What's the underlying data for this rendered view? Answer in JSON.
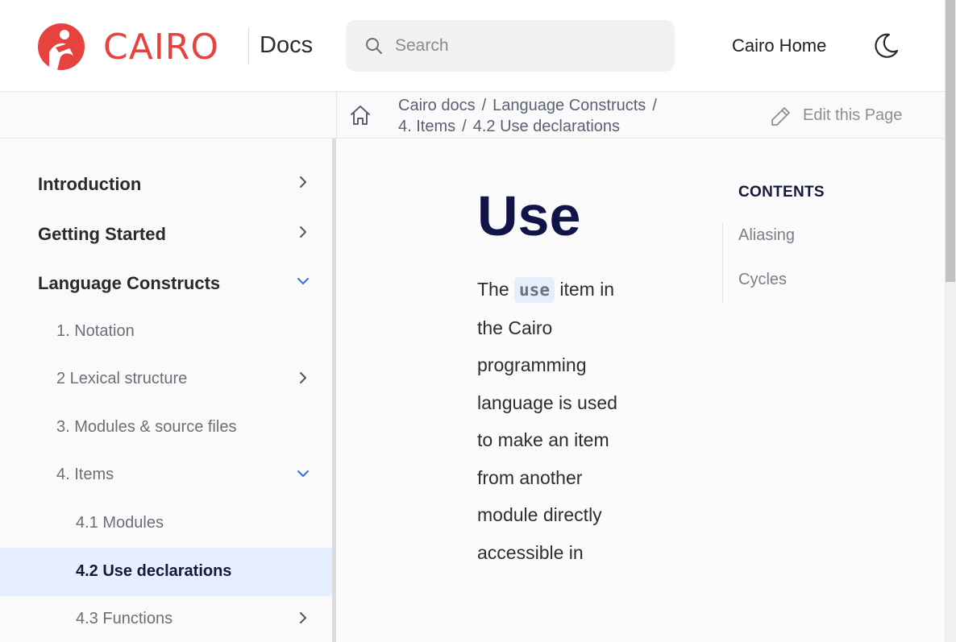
{
  "header": {
    "logo_text": "CAIRO",
    "docs_label": "Docs",
    "search_placeholder": "Search",
    "home_link": "Cairo Home"
  },
  "breadcrumb": {
    "items": [
      "Cairo docs",
      "Language Constructs",
      "4. Items",
      "4.2 Use declarations"
    ],
    "separator": "/",
    "edit_label": "Edit this Page"
  },
  "sidebar": {
    "items": [
      {
        "label": "Introduction",
        "level": 0,
        "chevron": "right"
      },
      {
        "label": "Getting Started",
        "level": 0,
        "chevron": "right"
      },
      {
        "label": "Language Constructs",
        "level": 0,
        "chevron": "down"
      },
      {
        "label": "1. Notation",
        "level": 1,
        "chevron": "none"
      },
      {
        "label": "2 Lexical structure",
        "level": 1,
        "chevron": "right"
      },
      {
        "label": "3. Modules & source files",
        "level": 1,
        "chevron": "none"
      },
      {
        "label": "4. Items",
        "level": 1,
        "chevron": "down"
      },
      {
        "label": "4.1 Modules",
        "level": 2,
        "chevron": "none"
      },
      {
        "label": "4.2 Use declarations",
        "level": 2,
        "chevron": "none",
        "active": true
      },
      {
        "label": "4.3 Functions",
        "level": 2,
        "chevron": "right"
      }
    ]
  },
  "content": {
    "title": "Use",
    "para_before": "The",
    "code": "use",
    "para_after": "item in the Cairo programming language is used to make an item from another module directly accessible in"
  },
  "toc": {
    "title": "CONTENTS",
    "items": [
      "Aliasing",
      "Cycles"
    ]
  },
  "colors": {
    "brand": "#e8423f",
    "heading": "#111446",
    "active_bg": "#e6efff",
    "accent_chevron": "#3b6fd8"
  }
}
